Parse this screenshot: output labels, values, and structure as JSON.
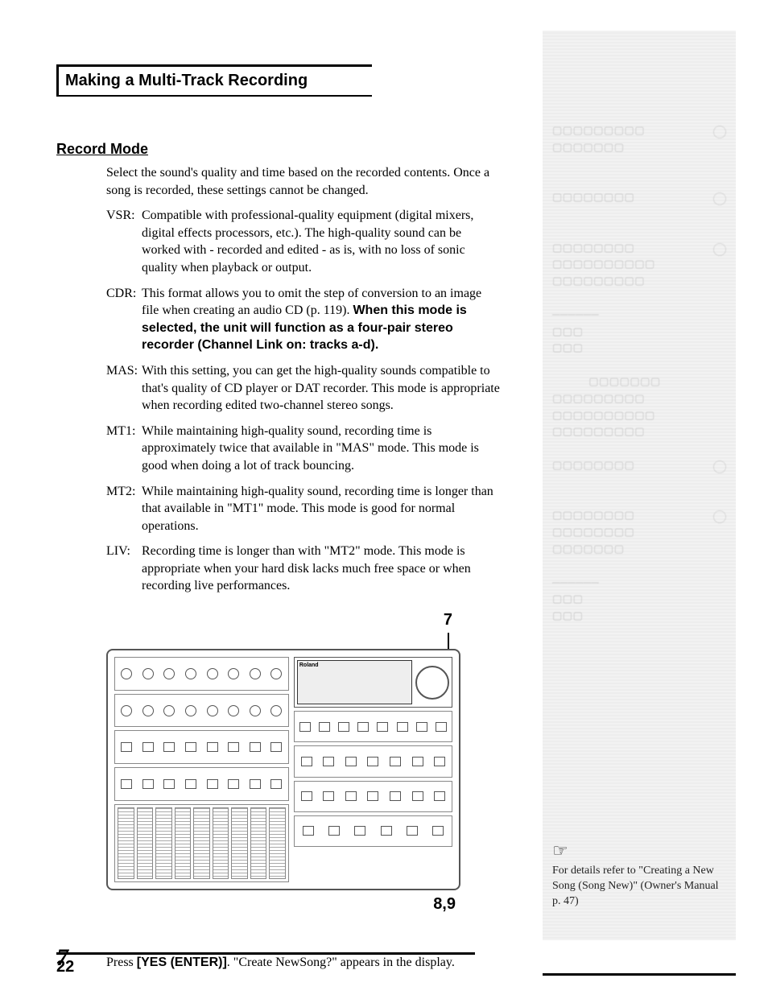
{
  "title": "Making a Multi-Track Recording",
  "subheading": "Record Mode",
  "intro": "Select the sound's quality and time based on the recorded contents. Once a song is recorded, these settings cannot be changed.",
  "modes": [
    {
      "term": "VSR:",
      "desc": "Compatible with professional-quality equipment (digital mixers, digital effects processors, etc.). The high-quality sound can be worked with - recorded and edited - as is, with no loss of sonic quality when playback or output."
    },
    {
      "term": "CDR:",
      "desc_pre": "This format allows you to omit the step of conversion to an image file when creating an audio CD (p. 119). ",
      "desc_bold": "When this mode is selected, the unit will function as a four-pair stereo recorder (Channel Link on: tracks a-d)."
    },
    {
      "term": "MAS:",
      "desc": "With this setting, you can get the high-quality sounds compatible to that's quality of CD player or DAT recorder. This mode is appropriate when recording edited two-channel stereo songs."
    },
    {
      "term": "MT1:",
      "desc": "While maintaining high-quality sound, recording time is approximately twice that available in \"MAS\" mode. This mode is good when doing a lot of track bouncing."
    },
    {
      "term": "MT2:",
      "desc": "While maintaining high-quality sound, recording time is longer than that available in \"MT1\" mode. This mode is good for normal operations."
    },
    {
      "term": "LIV:",
      "desc": "Recording time is longer than with \"MT2\" mode. This mode is appropriate when your hard disk lacks much free space or when recording live performances."
    }
  ],
  "callout_top": "7",
  "callout_bottom": "8,9",
  "device_brand": "Roland",
  "step7": {
    "num": "7",
    "text_pre": "Press ",
    "text_bold": "[YES (ENTER)]",
    "text_post": ". \"Create NewSong?\" appears in the display."
  },
  "side_note": {
    "lead": "For details refer to \"Creating a New Song (Song New)\" (Owner's Manual p. 47)"
  },
  "page_number": "22"
}
